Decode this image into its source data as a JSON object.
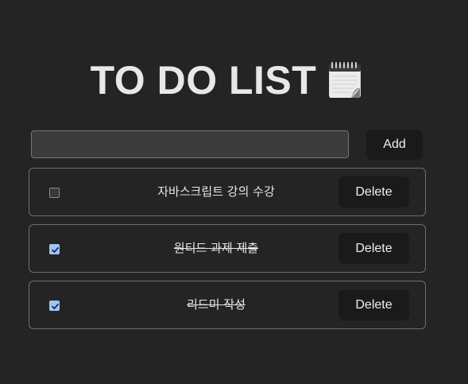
{
  "header": {
    "title": "TO DO LIST",
    "title_icon": "notepad-icon"
  },
  "new_todo": {
    "value": "",
    "placeholder": "",
    "add_label": "Add"
  },
  "todos": [
    {
      "text": "자바스크립트 강의 수강",
      "done": false,
      "delete_label": "Delete"
    },
    {
      "text": "원티드 과제 제출",
      "done": true,
      "delete_label": "Delete"
    },
    {
      "text": "리드미 작성",
      "done": true,
      "delete_label": "Delete"
    }
  ],
  "colors": {
    "background": "#242424",
    "button": "#1a1a1a",
    "checkbox_checked": "#9ec5fb"
  }
}
